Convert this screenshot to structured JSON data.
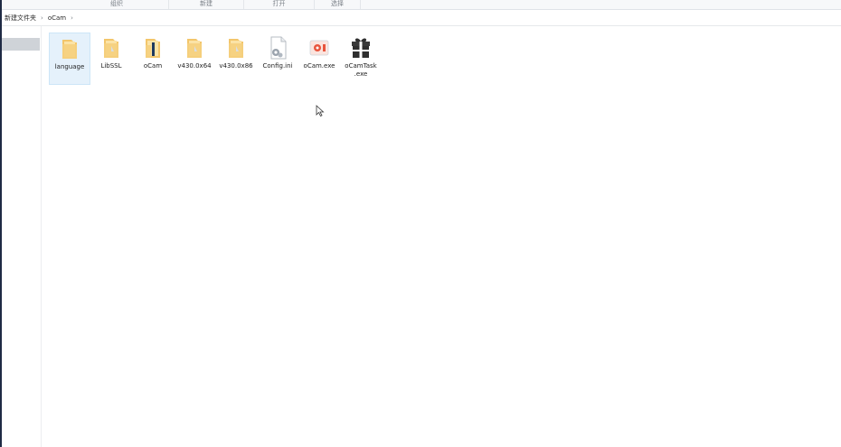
{
  "ribbon": {
    "groups": [
      "组织",
      "新建",
      "打开",
      "选择"
    ]
  },
  "address": {
    "crumbs": [
      "新建文件夹",
      "oCam"
    ],
    "separator": "›"
  },
  "files": [
    {
      "name": "language",
      "icon": "folder-icon",
      "selected": true
    },
    {
      "name": "LibSSL",
      "icon": "folder-icon",
      "selected": false
    },
    {
      "name": "oCam",
      "icon": "folder-icon",
      "selected": false
    },
    {
      "name": "v430.0x64",
      "icon": "folder-icon",
      "selected": false
    },
    {
      "name": "v430.0x86",
      "icon": "folder-icon",
      "selected": false
    },
    {
      "name": "Config.ini",
      "icon": "config-file-icon",
      "selected": false
    },
    {
      "name": "oCam.exe",
      "icon": "ocam-app-icon",
      "selected": false
    },
    {
      "name": "oCamTask\n.exe",
      "icon": "gift-box-icon",
      "selected": false
    }
  ],
  "colors": {
    "folder": "#f3c66b",
    "folder_light": "#fbe3a6",
    "ocam_red": "#e8553d",
    "selection": "#e5f1fb"
  }
}
